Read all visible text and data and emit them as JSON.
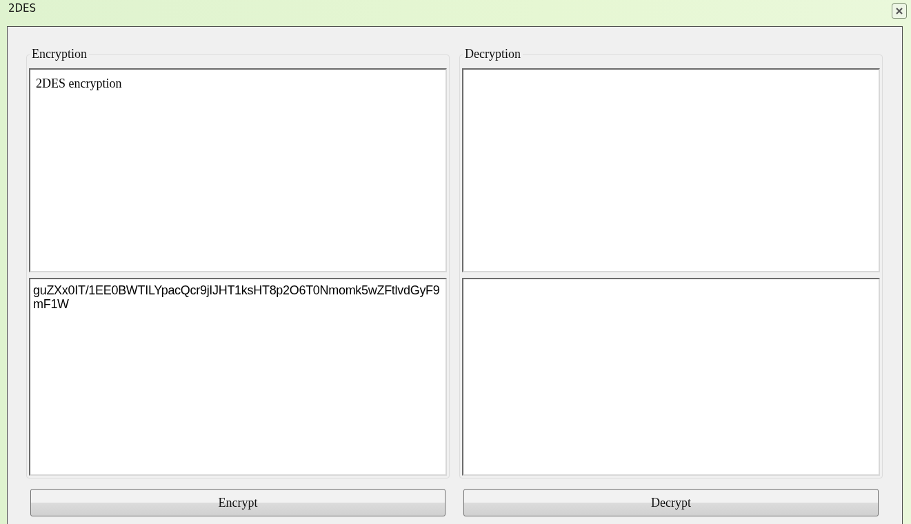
{
  "window": {
    "title": "2DES"
  },
  "groups": [
    {
      "title": "Encryption",
      "input": {
        "value": "2DES encryption"
      },
      "output": {
        "value": "guZXx0IT/1EE0BWTILYpacQcr9jIJHT1ksHT8p2O6T0Nmomk5wZFtlvdGyF9mF1W"
      },
      "button": "Encrypt"
    },
    {
      "title": "Decryption",
      "button": "Decrypt"
    }
  ]
}
